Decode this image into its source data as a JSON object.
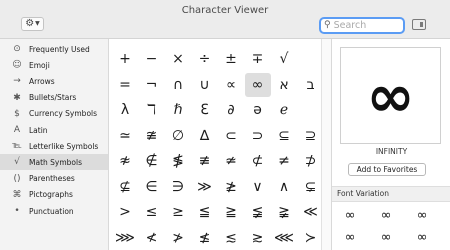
{
  "window": {
    "title": "Character Viewer"
  },
  "toolbar": {
    "action_icon": "gear-icon",
    "search_placeholder": "Search",
    "search_value": ""
  },
  "sidebar": {
    "selected": "Math Symbols",
    "items": [
      {
        "icon": "clock-icon",
        "glyph": "⊙",
        "label": "Frequently Used"
      },
      {
        "icon": "emoji-icon",
        "glyph": "☺",
        "label": "Emoji"
      },
      {
        "icon": "arrows-icon",
        "glyph": "→",
        "label": "Arrows"
      },
      {
        "icon": "bullets-icon",
        "glyph": "✱",
        "label": "Bullets/Stars"
      },
      {
        "icon": "currency-icon",
        "glyph": "$",
        "label": "Currency Symbols"
      },
      {
        "icon": "latin-icon",
        "glyph": "A",
        "label": "Latin"
      },
      {
        "icon": "letterlike-icon",
        "glyph": "℡",
        "label": "Letterlike Symbols"
      },
      {
        "icon": "math-icon",
        "glyph": "√",
        "label": "Math Symbols"
      },
      {
        "icon": "parentheses-icon",
        "glyph": "()",
        "label": "Parentheses"
      },
      {
        "icon": "pictographs-icon",
        "glyph": "⌘",
        "label": "Pictographs"
      },
      {
        "icon": "punctuation-icon",
        "glyph": "•",
        "label": "Punctuation"
      }
    ]
  },
  "grid": {
    "selected": "∞",
    "rows": [
      [
        "+",
        "−",
        "×",
        "÷",
        "±",
        "∓",
        "√"
      ],
      [
        "=",
        "¬",
        "∩",
        "∪",
        "∝",
        "∞",
        "א",
        "ב"
      ],
      [
        "λ",
        "ℸ",
        "ℏ",
        "ℇ",
        "∂",
        "ə",
        "ℯ"
      ],
      [
        "≃",
        "≇",
        "∅",
        "∆",
        "⊂",
        "⊃",
        "⊆",
        "⊇"
      ],
      [
        "≉",
        "∉",
        "≸",
        "≢",
        "≄",
        "⊄",
        "≠",
        "⊅"
      ],
      [
        "⊈",
        "∈",
        "∋",
        "≫",
        "≱",
        "∨",
        "∧",
        "⊊"
      ],
      [
        ">",
        "≤",
        "≥",
        "≦",
        "≧",
        "≨",
        "≩",
        "≪"
      ],
      [
        "⋙",
        "≮",
        "≯",
        "≰",
        "≲",
        "≳",
        "⋘",
        "≻"
      ]
    ]
  },
  "detail": {
    "glyph": "∞",
    "name": "INFINITY",
    "add_favorites_label": "Add to Favorites",
    "font_variation_title": "Font Variation",
    "variations": [
      "∞",
      "∞",
      "∞",
      "∞",
      "∞",
      "∞"
    ]
  }
}
